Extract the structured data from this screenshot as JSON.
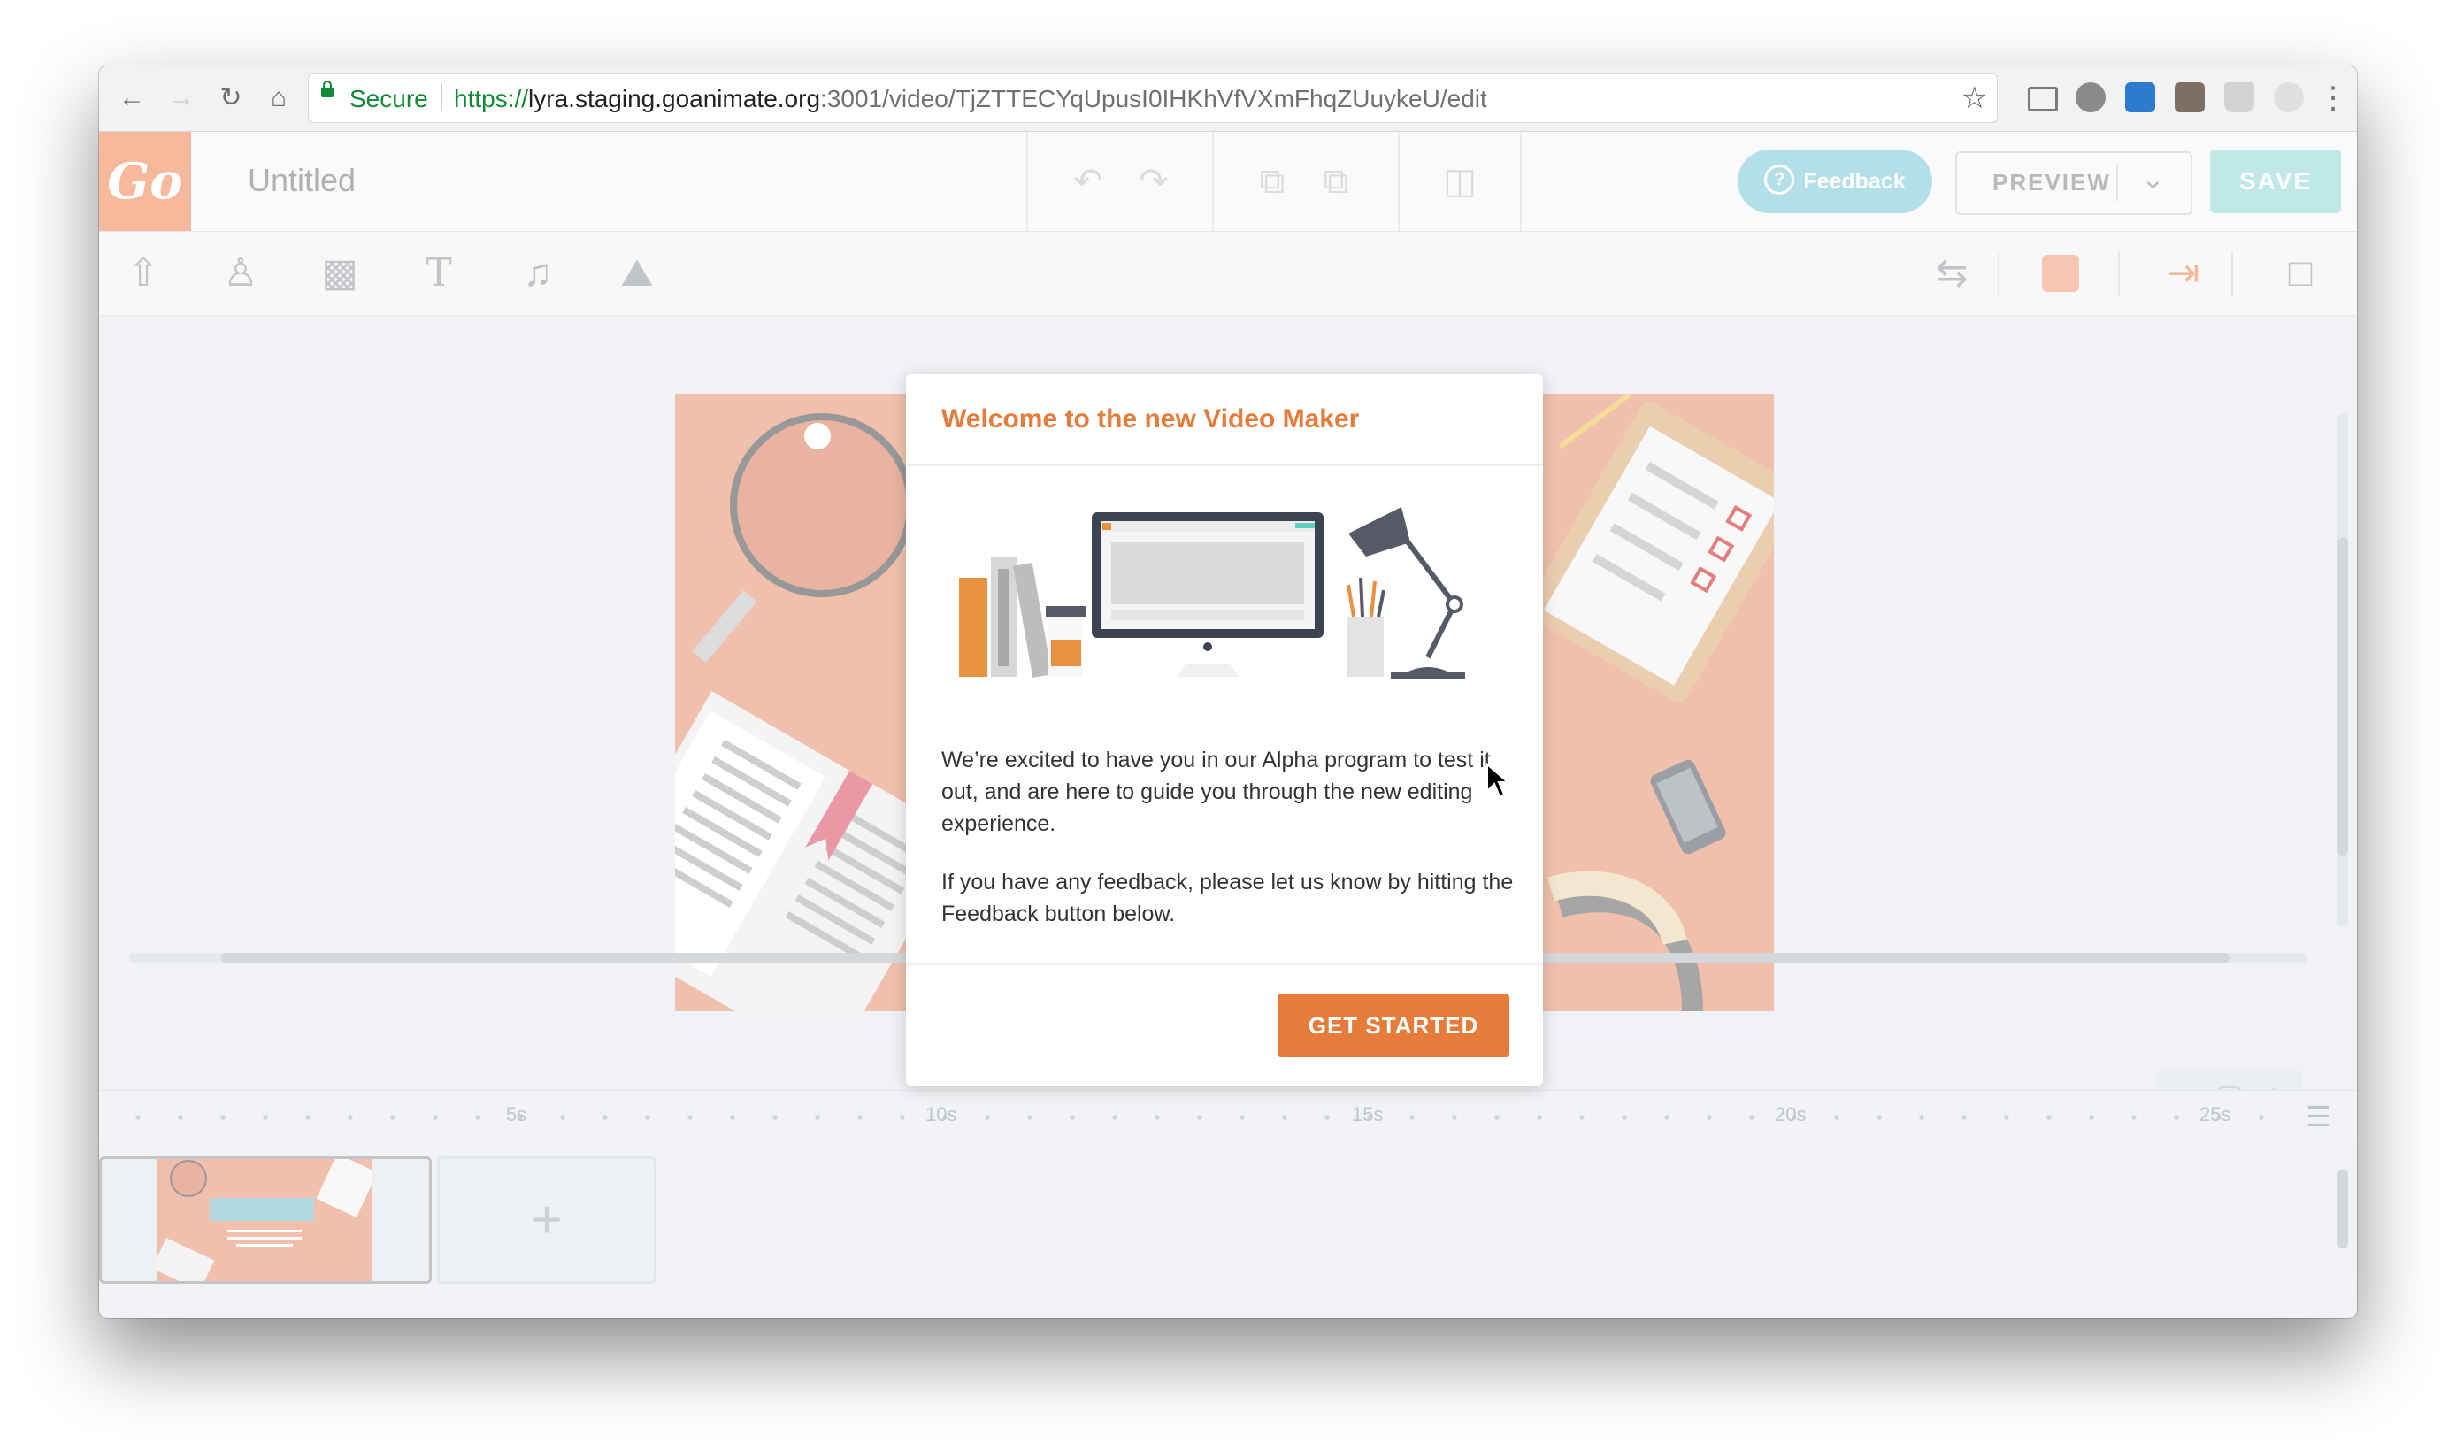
{
  "browser": {
    "secure_label": "Secure",
    "url_scheme": "https://",
    "url_host": "lyra.staging.goanimate.org",
    "url_rest": ":3001/video/TjZTTECYqUpusI0IHKhVfVXmFhqZUuykeU/edit"
  },
  "app": {
    "logo_text": "Go",
    "title": "Untitled",
    "feedback_label": "Feedback",
    "preview_label": "PREVIEW",
    "save_label": "SAVE",
    "brand_color": "#e57c3b"
  },
  "timeline": {
    "ticks": [
      "5s",
      "10s",
      "15s",
      "20s",
      "25s"
    ],
    "add_scene_label": "+"
  },
  "modal": {
    "title": "Welcome to the new Video Maker",
    "paragraph1": "We’re excited to have you in our Alpha program to test it out, and are here to guide you through the new editing experience.",
    "paragraph2": "If you have any feedback, please let us know by hitting the Feedback button below.",
    "cta_label": "GET STARTED"
  },
  "icons": [
    "back-icon",
    "forward-icon",
    "reload-icon",
    "home-icon",
    "star-icon",
    "undo-icon",
    "redo-icon",
    "copy-icon",
    "paste-icon",
    "trash-icon",
    "upload-icon",
    "character-icon",
    "prop-icon",
    "text-icon",
    "music-icon",
    "image-icon",
    "swap-icon",
    "enter-icon",
    "camera-icon"
  ]
}
